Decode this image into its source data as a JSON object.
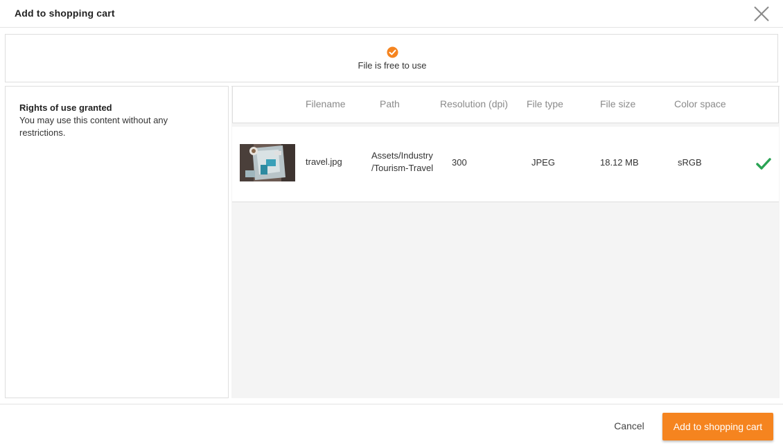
{
  "dialog": {
    "title": "Add to shopping cart",
    "close_icon": "close-icon"
  },
  "status": {
    "icon": "checkmark-circle-icon",
    "icon_color": "#f5841f",
    "text": "File is free to use"
  },
  "rights": {
    "title": "Rights of use granted",
    "description": "You may use this content without any restrictions."
  },
  "table": {
    "columns": [
      "Filename",
      "Path",
      "Resolution (dpi)",
      "File type",
      "File size",
      "Color space"
    ],
    "rows": [
      {
        "thumbnail": "travel-photo-thumbnail",
        "filename": "travel.jpg",
        "path_line1": "Assets/Industry",
        "path_line2": "/Tourism-Travel",
        "resolution": "300",
        "file_type": "JPEG",
        "file_size": "18.12 MB",
        "color_space": "sRGB",
        "status_icon": "check-icon",
        "status_color": "#2aa354"
      }
    ]
  },
  "footer": {
    "cancel_label": "Cancel",
    "submit_label": "Add to shopping cart",
    "accent_color": "#f5841f"
  }
}
